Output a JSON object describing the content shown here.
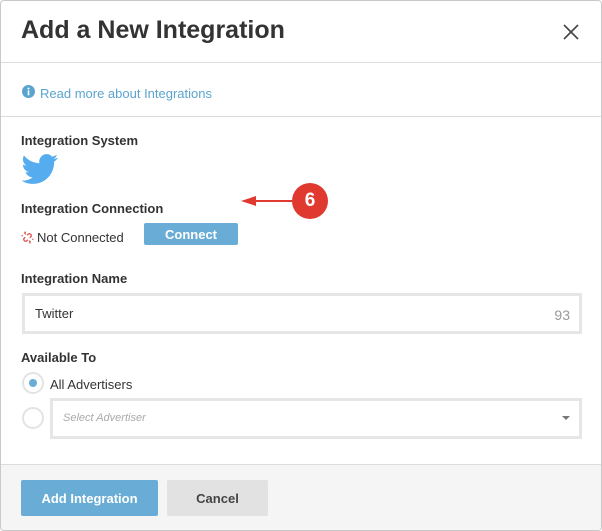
{
  "modal": {
    "title": "Add a New Integration",
    "close_icon": "close-icon"
  },
  "info": {
    "icon": "info-circle-icon",
    "link_text": "Read more about Integrations"
  },
  "integration_system": {
    "label": "Integration System",
    "icon": "twitter-bird-icon"
  },
  "integration_connection": {
    "label": "Integration Connection",
    "status_icon": "broken-link-icon",
    "status_text": "Not Connected",
    "connect_label": "Connect"
  },
  "annotation": {
    "badge_number": "6",
    "arrow_icon": "arrow-left-icon"
  },
  "integration_name": {
    "label": "Integration Name",
    "value": "Twitter",
    "remaining_chars": "93"
  },
  "available_to": {
    "label": "Available To",
    "option_all_label": "All Advertisers",
    "option_all_selected": true,
    "option_select_selected": false,
    "select_placeholder": "Select Advertiser"
  },
  "footer": {
    "add_label": "Add Integration",
    "cancel_label": "Cancel"
  },
  "colors": {
    "accent": "#69add6",
    "link": "#5aa4cf",
    "twitter": "#55acee",
    "annotation": "#e03a30",
    "status_error": "#d9534f"
  }
}
